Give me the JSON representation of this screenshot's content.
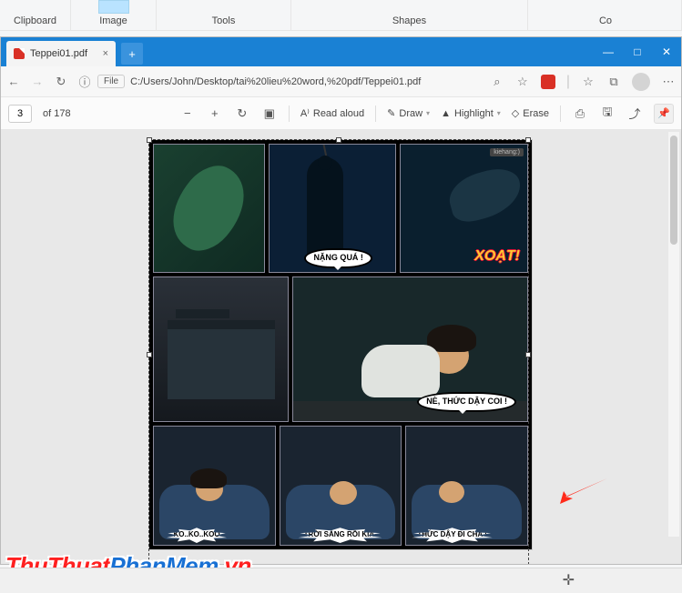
{
  "ribbon": {
    "clipboard": "Clipboard",
    "image": "Image",
    "tools": "Tools",
    "shapes": "Shapes",
    "co": "Co"
  },
  "window": {
    "minimize": "—",
    "maximize": "□",
    "close": "✕"
  },
  "tab": {
    "title": "Teppei01.pdf",
    "close": "×",
    "add": "+"
  },
  "addr": {
    "back": "←",
    "fwd": "→",
    "reload": "↻",
    "file_label": "File",
    "url": "C:/Users/John/Desktop/tai%20lieu%20word,%20pdf/Teppei01.pdf",
    "search": "⌕",
    "star": "☆",
    "fav": "☆",
    "collections": "⧉",
    "menu": "⋯"
  },
  "pdfbar": {
    "page_value": "3",
    "page_of": "of 178",
    "zoom_out": "−",
    "zoom_in": "+",
    "rotate": "↻",
    "fit": "▣",
    "readaloud_ico": "A⁾",
    "readaloud": "Read aloud",
    "draw_ico": "✎",
    "draw": "Draw",
    "highlight_ico": "▲",
    "highlight": "Highlight",
    "erase_ico": "◇",
    "erase": "Erase",
    "print": "⎙",
    "save": "🖫",
    "saveas": "⤴",
    "pin": "📌"
  },
  "comic": {
    "badge": "kiehang:)",
    "xoat": "XOẠT!",
    "bubble1": "NẶNG QUÁ !",
    "bubble2": "NÈ, THỨC DẬY COI !",
    "burst1": "KO..KO..KOO",
    "burst2": "TRỜI SÁNG RỒI KÌA.",
    "burst3": "THỨC DẬY ĐI CHA !"
  },
  "watermark": {
    "p1": "ThuThuat",
    "p2": "PhanMem",
    "p3": ".vn"
  },
  "cursor": "✛"
}
